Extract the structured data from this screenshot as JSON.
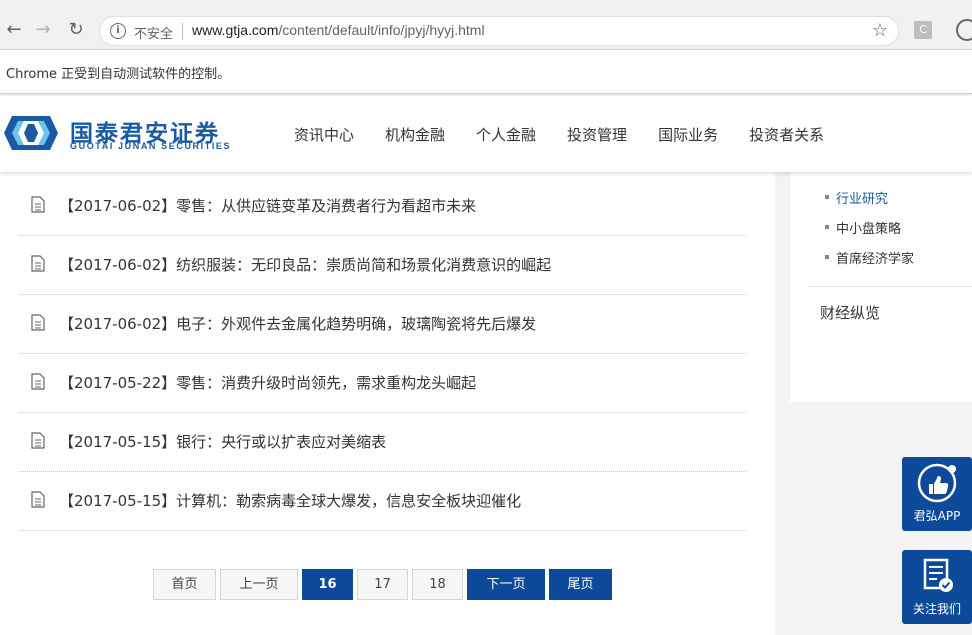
{
  "browser": {
    "security_label": "不安全",
    "url_host": "www.gtja.com",
    "url_path": "/content/default/info/jpyj/hyyj.html",
    "automation_notice": "Chrome 正受到自动测试软件的控制。",
    "ext_label": "C"
  },
  "site": {
    "logo_cn": "国泰君安证券",
    "logo_en": "GUOTAI JUNAN SECURITIES",
    "nav": [
      "资讯中心",
      "机构金融",
      "个人金融",
      "投资管理",
      "国际业务",
      "投资者关系"
    ]
  },
  "articles": [
    "【2017-06-02】零售：从供应链变革及消费者行为看超市未来",
    "【2017-06-02】纺织服装：无印良品：崇质尚简和场景化消费意识的崛起",
    "【2017-06-02】电子：外观件去金属化趋势明确，玻璃陶瓷将先后爆发",
    "【2017-05-22】零售：消费升级时尚领先，需求重构龙头崛起",
    "【2017-05-15】银行：央行或以扩表应对美缩表",
    "【2017-05-15】计算机：勒索病毒全球大爆发，信息安全板块迎催化"
  ],
  "pager": {
    "first": "首页",
    "prev": "上一页",
    "pages": [
      "16",
      "17",
      "18"
    ],
    "current": "16",
    "next": "下一页",
    "last": "尾页"
  },
  "sidebar": {
    "subitems": [
      "行业研究",
      "中小盘策略",
      "首席经济学家"
    ],
    "active": "行业研究",
    "category": "财经纵览"
  },
  "float": {
    "app_label": "君弘APP",
    "follow_label": "关注我们"
  },
  "colors": {
    "brand_blue": "#0e4a9a",
    "logo_blue": "#1a5aa3"
  }
}
